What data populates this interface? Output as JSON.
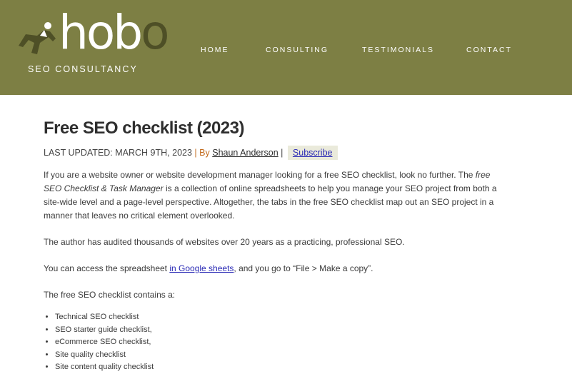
{
  "header": {
    "logo": {
      "word_light": "ho",
      "word_light2": "b",
      "word_dark": "o",
      "tagline": "SEO CONSULTANCY"
    },
    "nav": [
      "HOME",
      "CONSULTING",
      "TESTIMONIALS",
      "CONTACT"
    ]
  },
  "article": {
    "title": "Free SEO checklist (2023)",
    "meta": {
      "updated": "LAST UPDATED: MARCH 9TH, 2023",
      "sep1": "|",
      "by": "By",
      "author": "Shaun Anderson",
      "sep2": "|",
      "subscribe": "Subscribe"
    },
    "para1": {
      "before": "If you are a website owner or website development manager looking for a free SEO checklist, look no further. The ",
      "em": "free SEO Checklist & Task Manager",
      "after": " is a collection of online spreadsheets to help you manage your SEO project from both a site-wide level and a page-level perspective. Altogether, the tabs in the free SEO checklist map out an SEO project in a manner that leaves no critical element overlooked."
    },
    "para2": "The author has audited thousands of websites over 20 years as a practicing, professional SEO.",
    "para3": {
      "before": "You can access the spreadsheet ",
      "link": "in Google sheets",
      "after": ", and you go to “File > Make a copy”."
    },
    "para4": "The free SEO checklist contains a:",
    "list": [
      "Technical SEO checklist",
      "SEO starter guide checklist,",
      "eCommerce SEO checklist,",
      "Site quality checklist",
      "Site content quality checklist"
    ]
  },
  "colors": {
    "header_bg": "#7d7f44",
    "link": "#2a2ab5",
    "separator": "#c2691b"
  }
}
